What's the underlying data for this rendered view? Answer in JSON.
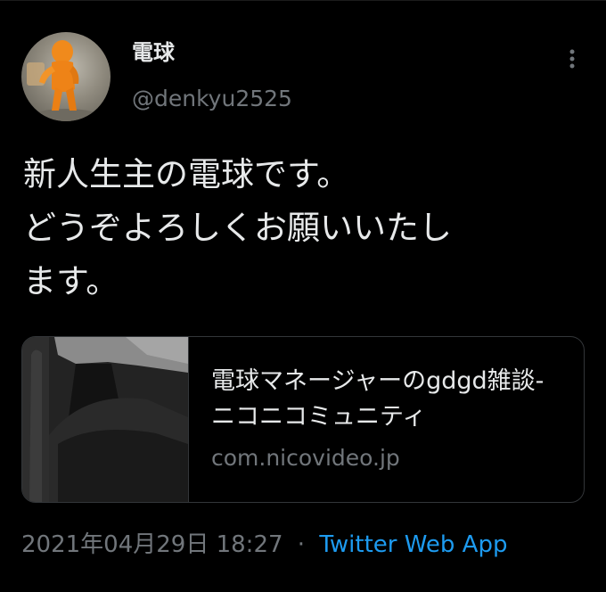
{
  "tweet": {
    "display_name": "電球",
    "handle": "@denkyu2525",
    "text": "新人生主の電球です。\nどうぞよろしくお願いいたし\nます。",
    "timestamp": "2021年04月29日 18:27",
    "separator": "·",
    "source": "Twitter Web App"
  },
  "card": {
    "title": "電球マネージャーのgdgd雑談-ニコニコミュニティ",
    "domain": "com.nicovideo.jp"
  },
  "icons": {
    "more": "more-vertical-icon"
  },
  "colors": {
    "background": "#000000",
    "text": "#e7e9ea",
    "secondary_text": "#71767b",
    "link": "#1d9bf0",
    "border": "#333639"
  }
}
